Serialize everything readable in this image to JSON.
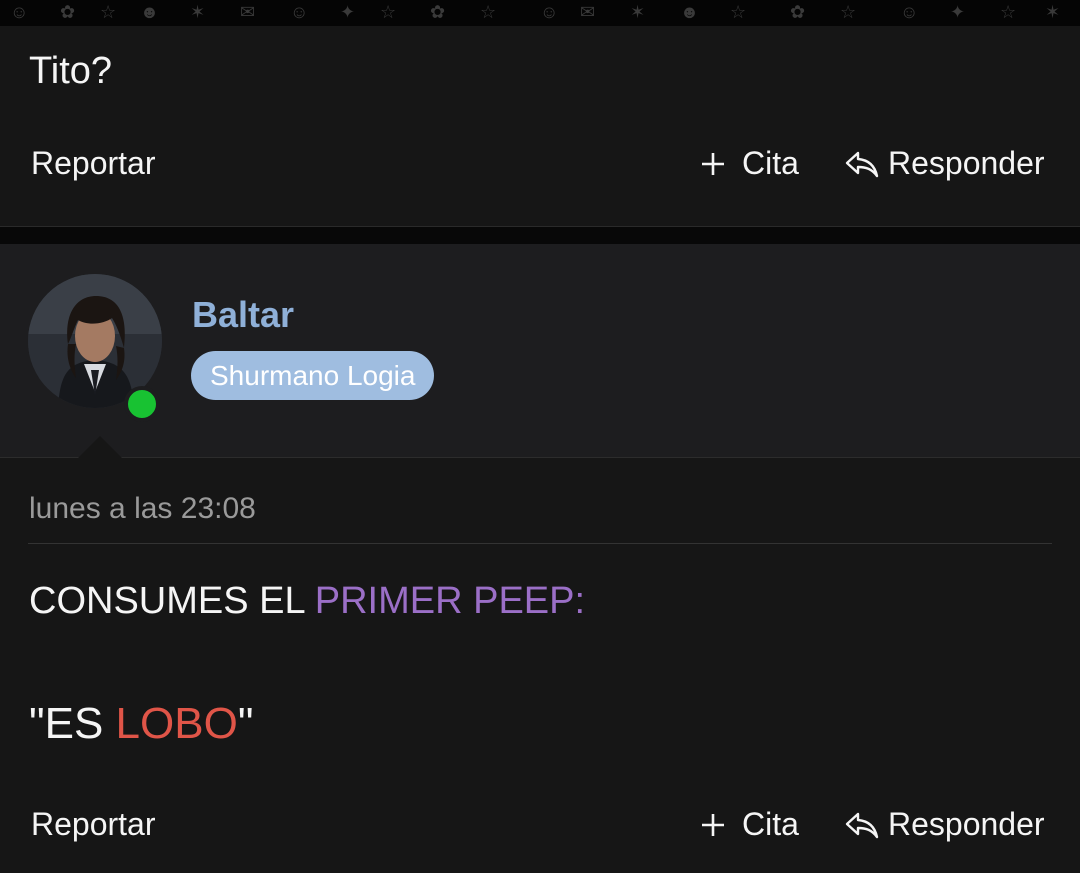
{
  "post_prev": {
    "message": "Tito?",
    "actions": {
      "report_label": "Reportar",
      "quote_label": "Cita",
      "reply_label": "Responder"
    }
  },
  "post": {
    "author": {
      "name": "Baltar",
      "role": "Shurmano Logia",
      "online": true
    },
    "timestamp": "lunes a las 23:08",
    "content": {
      "line1_prefix": "CONSUMES EL ",
      "line1_highlight": "PRIMER PEEP:",
      "line2_open": "\"ES ",
      "line2_highlight": "LOBO",
      "line2_close": "\""
    },
    "actions": {
      "report_label": "Reportar",
      "quote_label": "Cita",
      "reply_label": "Responder"
    }
  },
  "colors": {
    "username": "#8fb0d8",
    "badge": "#9fbde0",
    "highlight_purple": "#9b6fc7",
    "highlight_red": "#e05548",
    "online": "#18c232"
  },
  "icons": {
    "quote": "plus-icon",
    "reply": "reply-arrow-icon"
  }
}
